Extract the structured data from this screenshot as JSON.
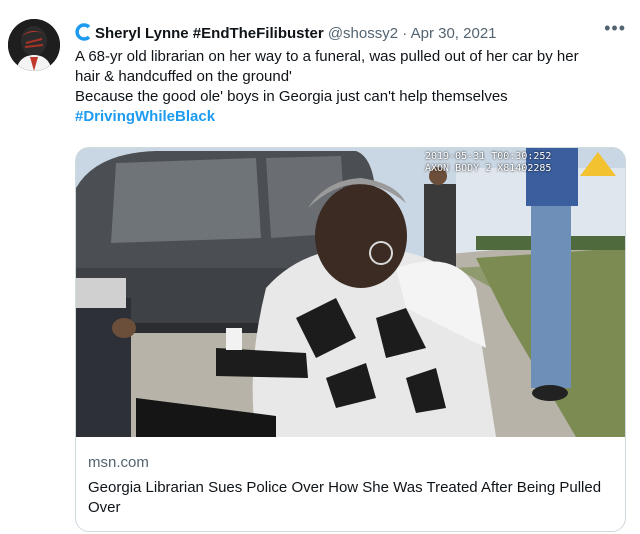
{
  "tweet": {
    "author_name": "Sheryl Lynne #EndTheFilibuster",
    "handle": "@shossy2",
    "separator": "·",
    "date": "Apr 30, 2021",
    "more_icon": "more-horizontal-icon",
    "lines": [
      "A 68-yr old librarian on her way to a funeral, was pulled out of her car by her",
      "hair & handcuffed on the ground'",
      "Because the good ole' boys in Georgia just can't help themselves"
    ],
    "hashtag": "#DrivingWhileBlack",
    "accent_color": "#1d9bf0"
  },
  "card": {
    "overlay_line1": "2019-05-31 T00:30:252",
    "overlay_line2": "AXON BODY 2 X81402285",
    "domain": "msn.com",
    "title": "Georgia Librarian Sues Police Over How She Was Treated After Being Pulled Over"
  }
}
